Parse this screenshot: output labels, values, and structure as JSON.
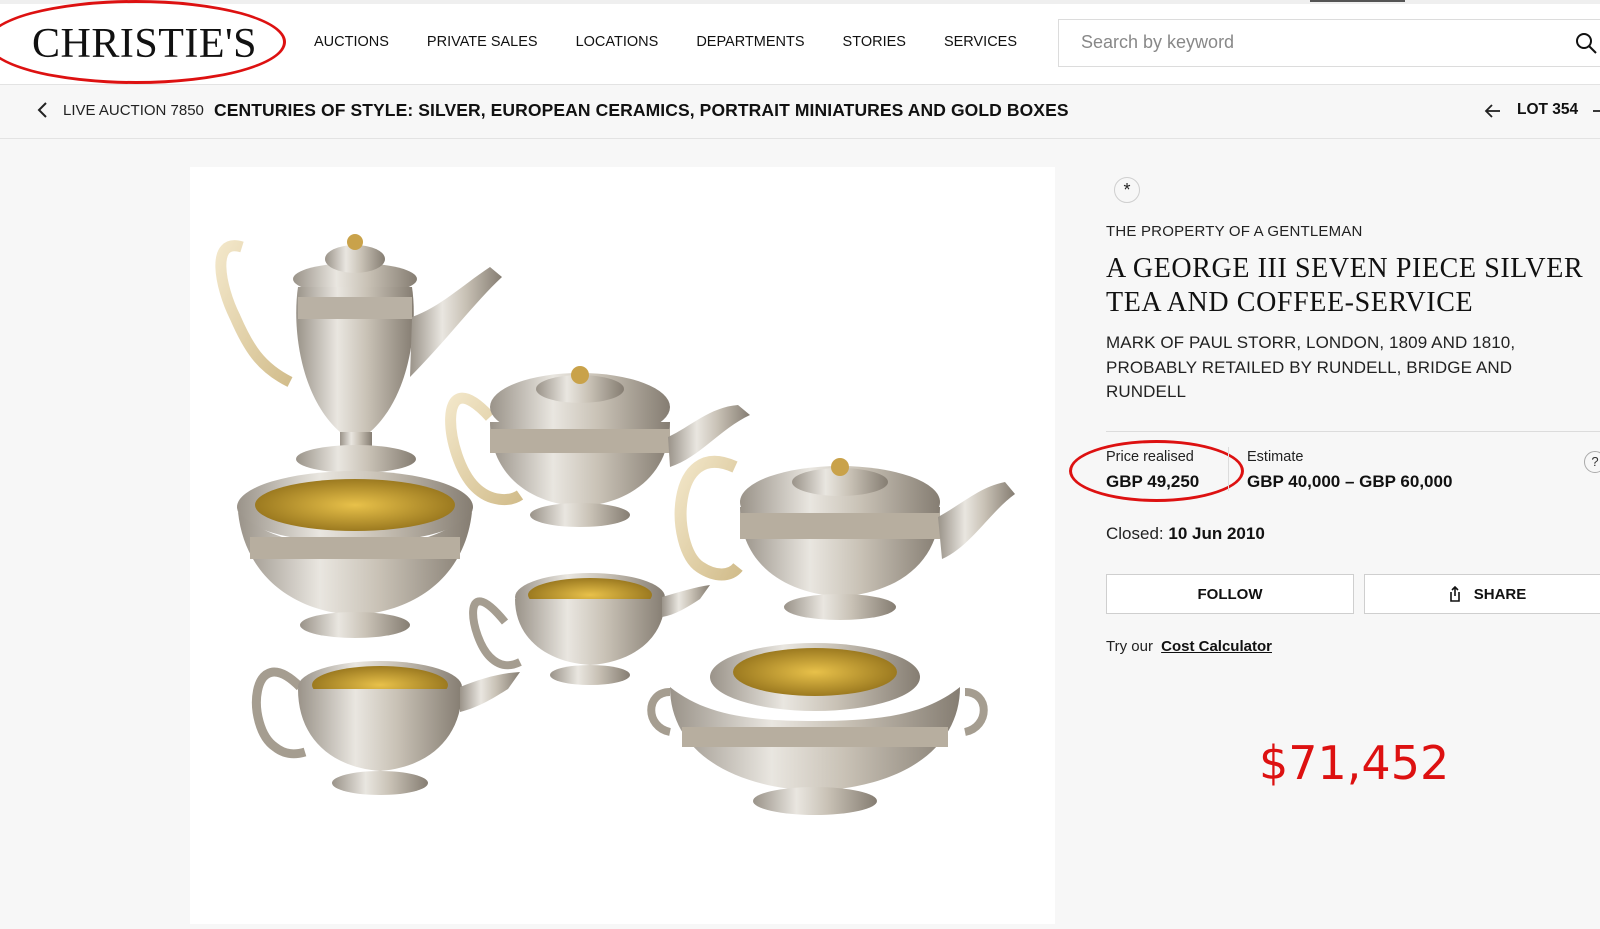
{
  "header": {
    "logo": "CHRISTIE'S",
    "nav": [
      "AUCTIONS",
      "PRIVATE SALES",
      "LOCATIONS",
      "DEPARTMENTS",
      "STORIES",
      "SERVICES"
    ],
    "search_placeholder": "Search by keyword"
  },
  "breadcrumb": {
    "sale_label": "LIVE AUCTION 7850",
    "sale_title": "CENTURIES OF STYLE: SILVER, EUROPEAN CERAMICS, PORTRAIT MINIATURES AND GOLD BOXES",
    "lot_label": "LOT 354"
  },
  "lot": {
    "icon_glyph": "*",
    "provenance": "THE PROPERTY OF A GENTLEMAN",
    "title": "A GEORGE III SEVEN PIECE SILVER TEA AND COFFEE-SERVICE",
    "subtitle": "MARK OF PAUL STORR, LONDON, 1809 AND 1810, PROBABLY RETAILED BY RUNDELL, BRIDGE AND RUNDELL",
    "price_label": "Price realised",
    "price_value": "GBP 49,250",
    "estimate_label": "Estimate",
    "estimate_value": "GBP 40,000 – GBP 60,000",
    "help_glyph": "?",
    "closed_label": "Closed:",
    "closed_date": "10 Jun 2010",
    "follow_label": "FOLLOW",
    "share_label": "SHARE",
    "calc_prefix": "Try our",
    "calc_link": "Cost Calculator"
  },
  "annotation": {
    "usd_value": "$71,452",
    "color": "#dd1111"
  },
  "image": {
    "subject": "silver-tea-and-coffee-service"
  }
}
